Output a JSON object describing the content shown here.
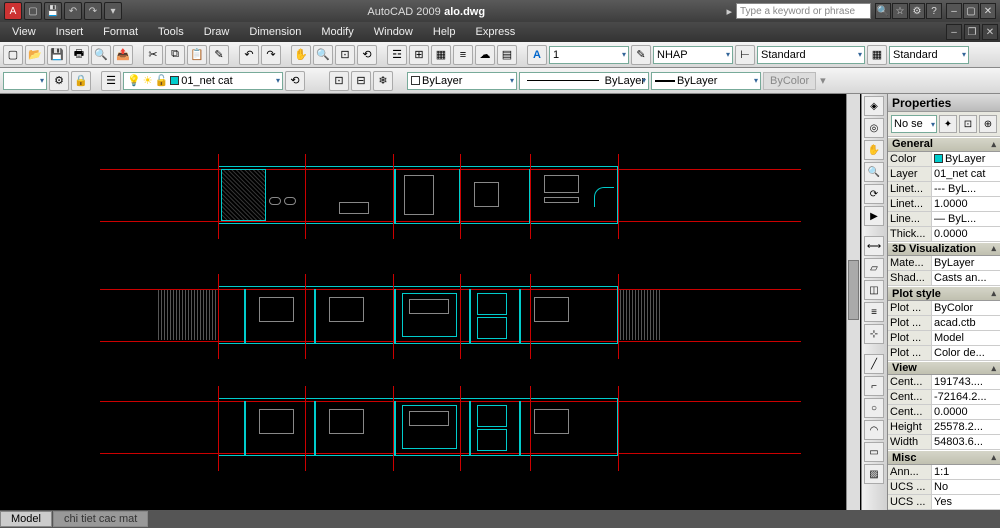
{
  "title_app": "AutoCAD 2009",
  "title_file": "alo.dwg",
  "search_placeholder": "Type a keyword or phrase",
  "menu": [
    "View",
    "Insert",
    "Format",
    "Tools",
    "Draw",
    "Dimension",
    "Modify",
    "Window",
    "Help",
    "Express"
  ],
  "tb1": {
    "textscale": "1",
    "textstyle": "NHAP",
    "dimstyle": "Standard",
    "tablestyle": "Standard"
  },
  "tb2": {
    "layer": "01_net cat",
    "color": "ByLayer",
    "ltype": "ByLayer",
    "lweight": "ByLayer",
    "plotstyle": "ByColor"
  },
  "props": {
    "title": "Properties",
    "sel": "No se",
    "general": {
      "label": "General",
      "items": [
        {
          "k": "Color",
          "v": "ByLayer",
          "sw": "#0cc"
        },
        {
          "k": "Layer",
          "v": "01_net cat"
        },
        {
          "k": "Linet...",
          "v": "--- ByL..."
        },
        {
          "k": "Linet...",
          "v": "1.0000"
        },
        {
          "k": "Line...",
          "v": "— ByL..."
        },
        {
          "k": "Thick...",
          "v": "0.0000"
        }
      ]
    },
    "viz": {
      "label": "3D Visualization",
      "items": [
        {
          "k": "Mate...",
          "v": "ByLayer"
        },
        {
          "k": "Shad...",
          "v": "Casts an..."
        }
      ]
    },
    "plot": {
      "label": "Plot style",
      "items": [
        {
          "k": "Plot ...",
          "v": "ByColor"
        },
        {
          "k": "Plot ...",
          "v": "acad.ctb"
        },
        {
          "k": "Plot ...",
          "v": "Model"
        },
        {
          "k": "Plot ...",
          "v": "Color de..."
        }
      ]
    },
    "view": {
      "label": "View",
      "items": [
        {
          "k": "Cent...",
          "v": "191743...."
        },
        {
          "k": "Cent...",
          "v": "-72164.2..."
        },
        {
          "k": "Cent...",
          "v": "0.0000"
        },
        {
          "k": "Height",
          "v": "25578.2..."
        },
        {
          "k": "Width",
          "v": "54803.6..."
        }
      ]
    },
    "misc": {
      "label": "Misc",
      "items": [
        {
          "k": "Ann...",
          "v": "1:1"
        },
        {
          "k": "UCS ...",
          "v": "No"
        },
        {
          "k": "UCS ...",
          "v": "Yes"
        }
      ]
    }
  },
  "tabs": {
    "model": "Model",
    "layout": "chi tiet cac mat"
  }
}
